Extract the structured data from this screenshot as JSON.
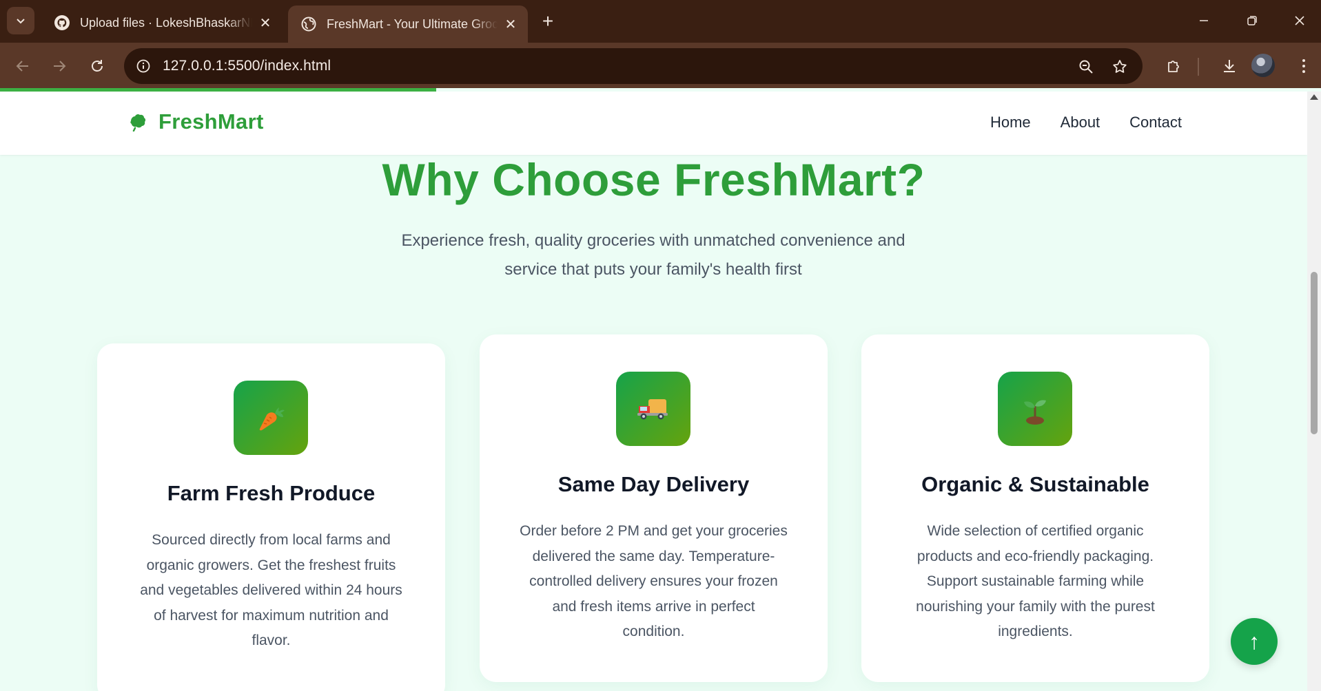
{
  "browser": {
    "tabs": [
      {
        "title": "Upload files · LokeshBhaskarNR",
        "favicon": "github-icon",
        "active": false
      },
      {
        "title": "FreshMart - Your Ultimate Grocery",
        "favicon": "globe-icon",
        "active": true
      }
    ],
    "url": "127.0.0.1:5500/index.html",
    "page_load_progress": 0.33
  },
  "site": {
    "brand": "FreshMart",
    "brand_color": "#2e9e3a",
    "nav": [
      "Home",
      "About",
      "Contact"
    ]
  },
  "section": {
    "title": "Why Choose FreshMart?",
    "subtitle_line1": "Experience fresh, quality groceries with unmatched convenience and",
    "subtitle_line2": "service that puts your family's health first"
  },
  "cards": [
    {
      "icon": "carrot-icon",
      "title": "Farm Fresh Produce",
      "lines": [
        "Sourced directly from local farms and",
        "organic growers. Get the freshest fruits",
        "and vegetables delivered within 24 hours",
        "of harvest for maximum nutrition and",
        "flavor."
      ]
    },
    {
      "icon": "delivery-truck-icon",
      "title": "Same Day Delivery",
      "lines": [
        "Order before 2 PM and get your groceries",
        "delivered the same day. Temperature-",
        "controlled delivery ensures your frozen",
        "and fresh items arrive in perfect",
        "condition."
      ]
    },
    {
      "icon": "seedling-icon",
      "title": "Organic & Sustainable",
      "lines": [
        "Wide selection of certified organic",
        "products and eco-friendly packaging.",
        "Support sustainable farming while",
        "nourishing your family with the purest",
        "ingredients."
      ]
    }
  ],
  "back_to_top_label": "↑"
}
